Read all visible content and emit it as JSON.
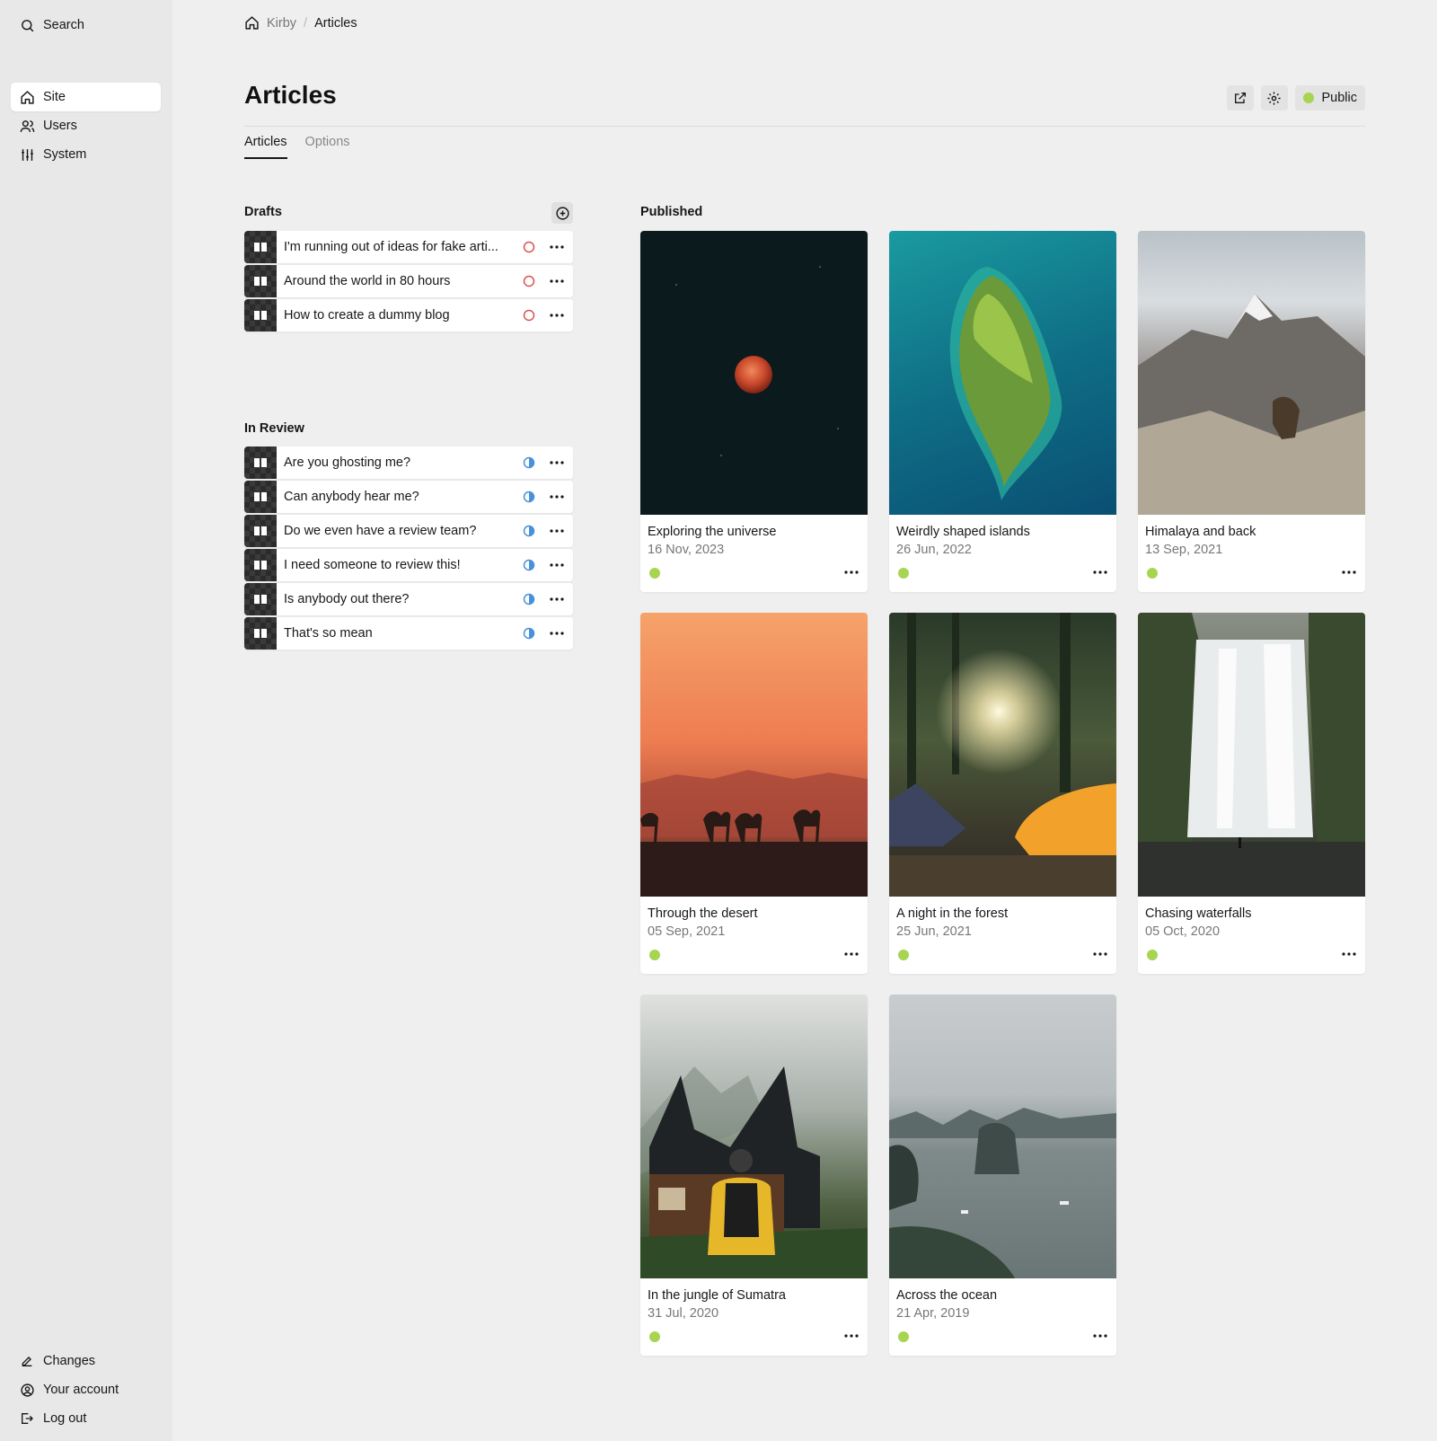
{
  "sidebar": {
    "search_label": "Search",
    "nav": [
      {
        "label": "Site",
        "icon": "home-icon",
        "active": true
      },
      {
        "label": "Users",
        "icon": "users-icon",
        "active": false
      },
      {
        "label": "System",
        "icon": "sliders-icon",
        "active": false
      }
    ],
    "bottom": [
      {
        "label": "Changes",
        "icon": "pen-icon"
      },
      {
        "label": "Your account",
        "icon": "account-icon"
      },
      {
        "label": "Log out",
        "icon": "logout-icon"
      }
    ]
  },
  "breadcrumb": {
    "home_label": "Kirby",
    "current": "Articles"
  },
  "header": {
    "title": "Articles",
    "status_label": "Public",
    "status_color": "#a7d451"
  },
  "tabs": [
    {
      "label": "Articles",
      "active": true
    },
    {
      "label": "Options",
      "active": false
    }
  ],
  "drafts": {
    "label": "Drafts",
    "status_color": "#d9534f",
    "items": [
      {
        "title": "I'm running out of ideas for fake arti..."
      },
      {
        "title": "Around the world in 80 hours"
      },
      {
        "title": "How to create a dummy blog"
      }
    ]
  },
  "in_review": {
    "label": "In Review",
    "status_color": "#4a90d9",
    "items": [
      {
        "title": "Are you ghosting me?"
      },
      {
        "title": "Can anybody hear me?"
      },
      {
        "title": "Do we even have a review team?"
      },
      {
        "title": "I need someone to review this!"
      },
      {
        "title": "Is anybody out there?"
      },
      {
        "title": "That's so mean"
      }
    ]
  },
  "published": {
    "label": "Published",
    "items": [
      {
        "title": "Exploring the universe",
        "date": "16 Nov, 2023"
      },
      {
        "title": "Weirdly shaped islands",
        "date": "26 Jun, 2022"
      },
      {
        "title": "Himalaya and back",
        "date": "13 Sep, 2021"
      },
      {
        "title": "Through the desert",
        "date": "05 Sep, 2021"
      },
      {
        "title": "A night in the forest",
        "date": "25 Jun, 2021"
      },
      {
        "title": "Chasing waterfalls",
        "date": "05 Oct, 2020"
      },
      {
        "title": "In the jungle of Sumatra",
        "date": "31 Jul, 2020"
      },
      {
        "title": "Across the ocean",
        "date": "21 Apr, 2019"
      }
    ]
  }
}
